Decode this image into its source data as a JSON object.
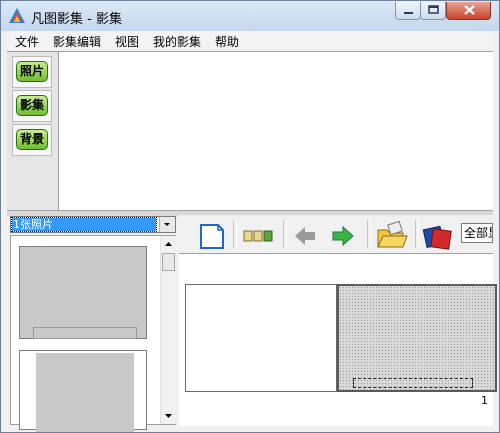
{
  "window": {
    "title": "凡图影集 - 影集"
  },
  "menu": {
    "items": [
      "文件",
      "影集编辑",
      "视图",
      "我的影集",
      "帮助"
    ]
  },
  "sidebar": {
    "buttons": [
      "照片",
      "影集",
      "背景"
    ]
  },
  "photo_combo": {
    "value": "1张照片"
  },
  "toolbar": {
    "icons": [
      "new-page-icon",
      "layout-icon",
      "back-arrow-icon",
      "forward-arrow-icon",
      "open-folder-icon",
      "album-icon"
    ],
    "select_value": "全部显"
  },
  "canvas": {
    "page_number": "1"
  },
  "colors": {
    "selection": "#3399ff",
    "button_green": "#6fbd32",
    "close_red": "#c7432b"
  }
}
